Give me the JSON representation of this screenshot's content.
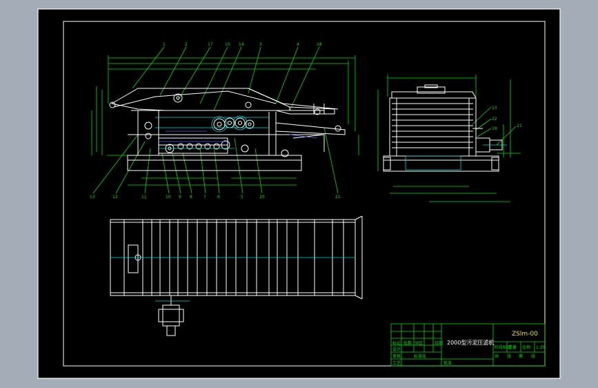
{
  "drawing": {
    "title": "2000型污泥压滤机",
    "code": "ZSlm-00",
    "scale": "1:25"
  },
  "callouts_top": [
    "1",
    "2",
    "17",
    "15",
    "14",
    "3",
    "4",
    "18"
  ],
  "callouts_bottom": [
    "13",
    "12",
    "11",
    "10",
    "9",
    "8",
    "7",
    "6",
    "5",
    "20",
    "21"
  ],
  "callouts_side": [
    "13",
    "22",
    "19",
    "21"
  ],
  "title_block": {
    "label_left": [
      "标记",
      "设计",
      "审核",
      "工艺",
      "日期"
    ],
    "label_mid": [
      "处数",
      "分区",
      "标准化",
      "批准"
    ],
    "label_stage": [
      "阶段标记",
      "重量",
      "比例"
    ],
    "label_sheet": [
      "共",
      "张",
      "第",
      "张"
    ]
  },
  "colors": {
    "background": "#a4acb8",
    "paper": "#000000",
    "lines": "#ffffff",
    "dims": "#00e000",
    "accent": "#00d8d8",
    "title": "#e8e800"
  }
}
